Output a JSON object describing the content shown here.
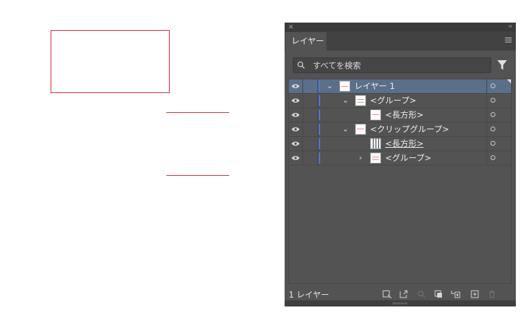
{
  "panel": {
    "title_tab": "レイヤー",
    "close_glyph": "×",
    "collapse_glyph": "‹‹"
  },
  "search": {
    "placeholder": "すべてを検索"
  },
  "layers": [
    {
      "label": "レイヤー 1",
      "indent": 0,
      "chevron": "⌄",
      "selected": true
    },
    {
      "label": "<グループ>",
      "indent": 1,
      "chevron": "⌄",
      "selected": false
    },
    {
      "label": "<長方形>",
      "indent": 2,
      "chevron": "",
      "selected": false
    },
    {
      "label": "<クリップグループ>",
      "indent": 1,
      "chevron": "⌄",
      "selected": false
    },
    {
      "label": "<長方形>",
      "indent": 2,
      "chevron": "",
      "selected": false,
      "underlined": true
    },
    {
      "label": "<グループ>",
      "indent": 2,
      "chevron": "›",
      "selected": false
    }
  ],
  "footer": {
    "layer_count": "1 レイヤー"
  },
  "colors": {
    "panel_bg": "#535353",
    "selection": "#5a6f89",
    "layer_color": "#4f74e6",
    "artwork_stroke": "#d9242f"
  }
}
